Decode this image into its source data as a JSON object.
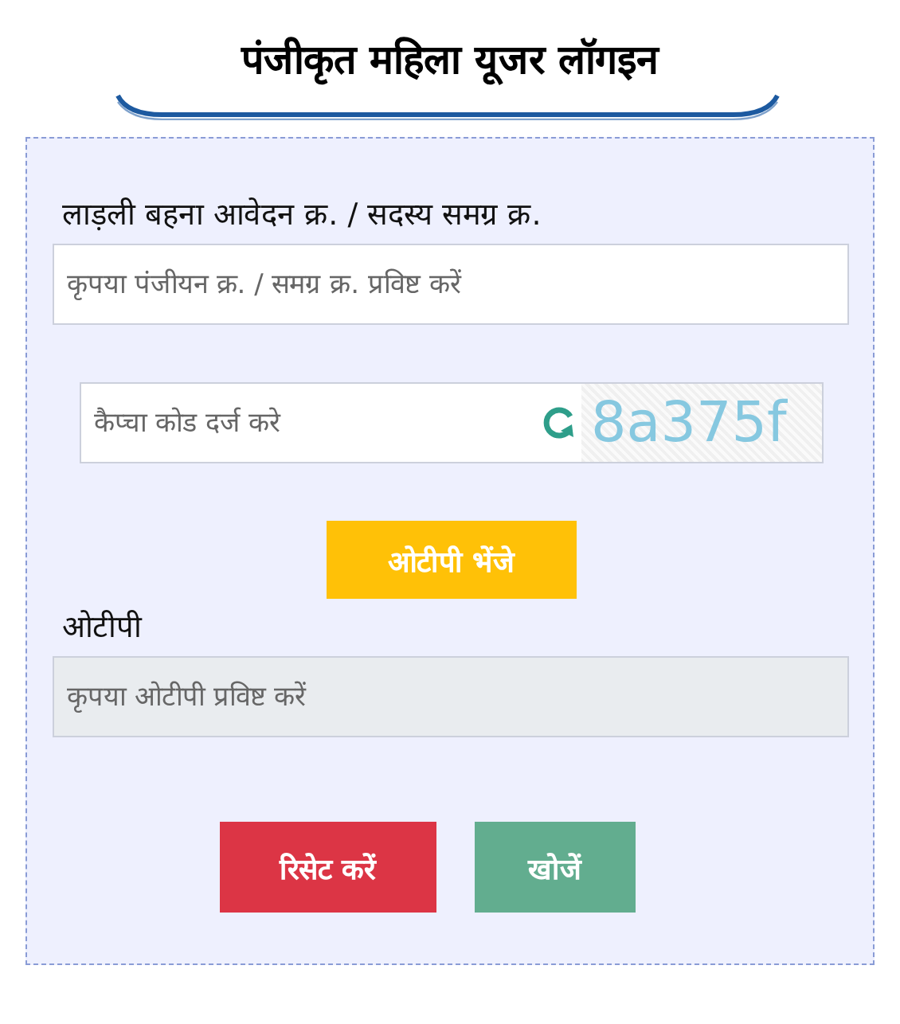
{
  "title": "पंजीकृत महिला यूजर लॉगइन",
  "id_field": {
    "label": "लाड़ली बहना आवेदन क्र. / सदस्य समग्र क्र.",
    "placeholder": "कृपया पंजीयन क्र. / समग्र क्र. प्रविष्ट करें"
  },
  "captcha": {
    "placeholder": "कैप्चा कोड दर्ज करे",
    "code": "8a375f"
  },
  "send_otp_button": "ओटीपी भेंजे",
  "otp_field": {
    "label": "ओटीपी",
    "placeholder": "कृपया ओटीपी प्रविष्ट करें",
    "disabled": true
  },
  "buttons": [
    {
      "label": "रिसेट करें",
      "kind": "reset"
    },
    {
      "label": "खोजें",
      "kind": "search"
    }
  ]
}
